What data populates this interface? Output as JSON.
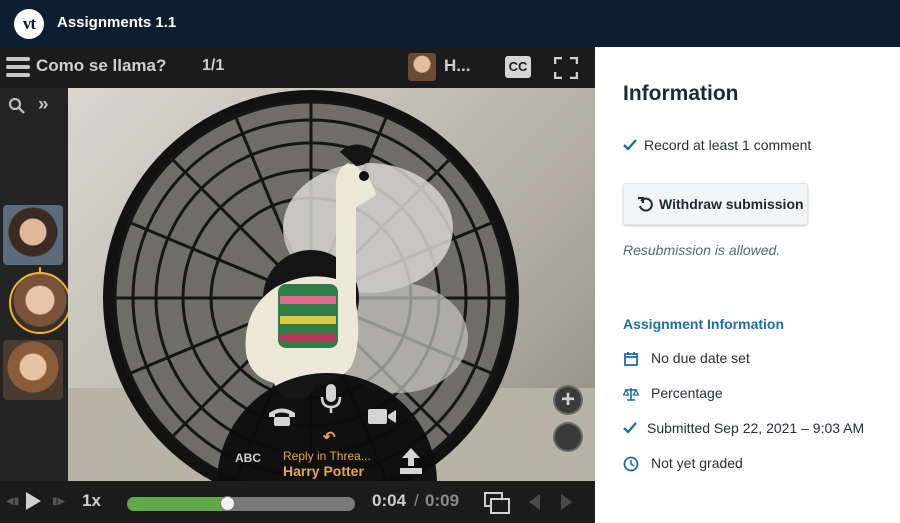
{
  "app": {
    "logo": "vt",
    "title": "Assignments 1.1"
  },
  "player": {
    "thread_title": "Como se llama?",
    "thread_count": "1/1",
    "owner_name": "H...",
    "cc_label": "CC",
    "recorder": {
      "abc_label": "ABC",
      "reply_label": "Reply in Threa...",
      "reply_name": "Harry Potter"
    },
    "zoom_in_label": "+",
    "controls": {
      "speed": "1x",
      "current_time": "0:04",
      "separator": "/",
      "total_time": "0:09",
      "progress_fraction": 0.44
    }
  },
  "info": {
    "heading": "Information",
    "requirement": "Record at least 1 comment",
    "withdraw_label": "Withdraw submission",
    "resubmission_note": "Resubmission is allowed.",
    "assignment_heading": "Assignment Information",
    "due": "No due date set",
    "grading": "Percentage",
    "submitted": "Submitted Sep 22, 2021 – 9:03 AM",
    "grade_status": "Not yet graded"
  },
  "colors": {
    "top_bar": "#0b1e32",
    "accent_blue": "#1a6fb0",
    "reply_gold": "#e6a64a",
    "selected_ring": "#f0b52a",
    "progress_green": "#62a94a"
  },
  "icons": {
    "menu": "hamburger-icon",
    "fullscreen": "fullscreen-icon",
    "search": "search-icon",
    "expand": "double-chevron-right-icon",
    "phone": "phone-icon",
    "mic": "microphone-icon",
    "video": "video-camera-icon",
    "upload": "upload-icon",
    "play": "play-icon",
    "pip": "picture-in-picture-icon",
    "check": "check-icon",
    "undo": "undo-icon",
    "calendar": "calendar-icon",
    "scale": "scale-icon",
    "clock": "clock-icon"
  }
}
